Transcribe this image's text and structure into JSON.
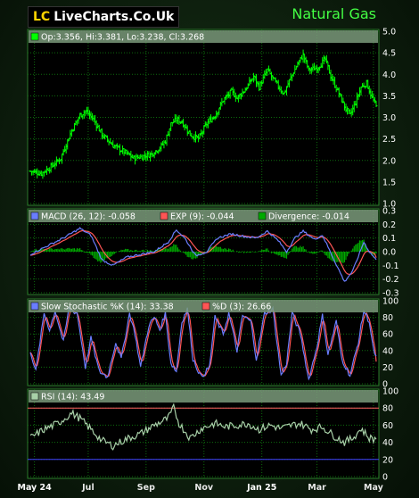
{
  "header": {
    "logo_prefix": "LC",
    "logo_text": "LiveCharts.Co.Uk",
    "title": "Natural Gas"
  },
  "colors": {
    "price": "#00ff00",
    "macd": "#6a7dff",
    "signal": "#ff5555",
    "divergence": "#00aa00",
    "slow_k": "#6a7dff",
    "slow_d": "#ff5555",
    "rsi": "#a8d0a8",
    "grid": "#0d6b0d",
    "rsi_upper": "#ff6060",
    "rsi_lower": "#4040ff"
  },
  "chart_data": [
    {
      "type": "ohlc",
      "legend": "Op:3.356, Hi:3.381, Lo:3.238, Cl:3.268",
      "yticks": [
        "5.0",
        "4.5",
        "4.0",
        "3.5",
        "3.0",
        "2.5",
        "2.0",
        "1.5",
        "1.0"
      ],
      "ylim": [
        1.0,
        5.0
      ],
      "anchors": [
        [
          0,
          1.75
        ],
        [
          8,
          1.7
        ],
        [
          15,
          1.85
        ],
        [
          22,
          2.05
        ],
        [
          30,
          2.7
        ],
        [
          36,
          3.05
        ],
        [
          40,
          3.15
        ],
        [
          46,
          2.95
        ],
        [
          52,
          2.6
        ],
        [
          60,
          2.35
        ],
        [
          68,
          2.2
        ],
        [
          75,
          2.05
        ],
        [
          82,
          2.1
        ],
        [
          88,
          2.15
        ],
        [
          94,
          2.3
        ],
        [
          98,
          2.45
        ],
        [
          102,
          2.85
        ],
        [
          106,
          2.95
        ],
        [
          110,
          2.9
        ],
        [
          116,
          2.6
        ],
        [
          122,
          2.5
        ],
        [
          128,
          2.85
        ],
        [
          134,
          3.05
        ],
        [
          140,
          3.4
        ],
        [
          146,
          3.6
        ],
        [
          150,
          3.45
        ],
        [
          156,
          3.65
        ],
        [
          162,
          3.95
        ],
        [
          166,
          3.7
        ],
        [
          172,
          4.1
        ],
        [
          178,
          3.8
        ],
        [
          184,
          3.55
        ],
        [
          188,
          3.85
        ],
        [
          194,
          4.25
        ],
        [
          198,
          4.45
        ],
        [
          202,
          4.1
        ],
        [
          208,
          4.15
        ],
        [
          214,
          4.35
        ],
        [
          218,
          3.95
        ],
        [
          224,
          3.55
        ],
        [
          228,
          3.25
        ],
        [
          232,
          3.05
        ],
        [
          236,
          3.35
        ],
        [
          240,
          3.7
        ],
        [
          244,
          3.8
        ],
        [
          248,
          3.45
        ],
        [
          251,
          3.27
        ]
      ],
      "last": {
        "open": 3.356,
        "high": 3.381,
        "low": 3.238,
        "close": 3.268
      }
    },
    {
      "type": "macd",
      "legend": {
        "macd": "MACD (26, 12): -0.058",
        "signal": "EXP (9): -0.044",
        "divergence": "Divergence: -0.014"
      },
      "yticks": [
        "0.3",
        "0.2",
        "0.1",
        "0.0",
        "-0.1",
        "-0.2",
        "-0.3"
      ],
      "ylim": [
        -0.3,
        0.3
      ],
      "macd_anchors": [
        [
          0,
          -0.02
        ],
        [
          12,
          0.04
        ],
        [
          24,
          0.1
        ],
        [
          36,
          0.17
        ],
        [
          44,
          0.12
        ],
        [
          52,
          -0.06
        ],
        [
          60,
          -0.1
        ],
        [
          70,
          -0.04
        ],
        [
          80,
          -0.02
        ],
        [
          90,
          0.0
        ],
        [
          100,
          0.07
        ],
        [
          106,
          0.16
        ],
        [
          112,
          0.1
        ],
        [
          120,
          -0.03
        ],
        [
          128,
          0.0
        ],
        [
          136,
          0.1
        ],
        [
          146,
          0.13
        ],
        [
          156,
          0.11
        ],
        [
          164,
          0.1
        ],
        [
          172,
          0.15
        ],
        [
          180,
          0.08
        ],
        [
          186,
          0.0
        ],
        [
          192,
          0.1
        ],
        [
          198,
          0.15
        ],
        [
          206,
          0.09
        ],
        [
          212,
          0.12
        ],
        [
          220,
          -0.05
        ],
        [
          228,
          -0.22
        ],
        [
          234,
          -0.14
        ],
        [
          242,
          0.07
        ],
        [
          246,
          0.0
        ],
        [
          251,
          -0.058
        ]
      ],
      "signal_last": -0.044,
      "divergence_last": -0.014
    },
    {
      "type": "stochastic",
      "legend": {
        "k": "Slow Stochastic %K (14): 33.38",
        "d": "%D (3): 26.66"
      },
      "yticks": [
        "100",
        "80",
        "60",
        "40",
        "20",
        "0"
      ],
      "ylim": [
        0,
        100
      ],
      "k_anchors": [
        [
          0,
          40
        ],
        [
          4,
          15
        ],
        [
          10,
          85
        ],
        [
          14,
          65
        ],
        [
          18,
          88
        ],
        [
          24,
          50
        ],
        [
          28,
          90
        ],
        [
          34,
          85
        ],
        [
          40,
          20
        ],
        [
          44,
          55
        ],
        [
          50,
          15
        ],
        [
          56,
          8
        ],
        [
          62,
          50
        ],
        [
          66,
          30
        ],
        [
          72,
          85
        ],
        [
          76,
          60
        ],
        [
          80,
          20
        ],
        [
          86,
          70
        ],
        [
          90,
          80
        ],
        [
          94,
          65
        ],
        [
          98,
          85
        ],
        [
          102,
          25
        ],
        [
          106,
          15
        ],
        [
          110,
          75
        ],
        [
          114,
          90
        ],
        [
          118,
          30
        ],
        [
          124,
          8
        ],
        [
          130,
          20
        ],
        [
          134,
          80
        ],
        [
          140,
          60
        ],
        [
          144,
          85
        ],
        [
          150,
          40
        ],
        [
          154,
          82
        ],
        [
          160,
          75
        ],
        [
          164,
          30
        ],
        [
          170,
          85
        ],
        [
          176,
          90
        ],
        [
          182,
          10
        ],
        [
          186,
          25
        ],
        [
          190,
          85
        ],
        [
          196,
          60
        ],
        [
          202,
          5
        ],
        [
          208,
          45
        ],
        [
          212,
          82
        ],
        [
          216,
          35
        ],
        [
          222,
          75
        ],
        [
          226,
          30
        ],
        [
          232,
          10
        ],
        [
          238,
          50
        ],
        [
          242,
          88
        ],
        [
          246,
          75
        ],
        [
          249,
          40
        ],
        [
          251,
          33.38
        ]
      ],
      "d_last": 26.66
    },
    {
      "type": "rsi",
      "legend": "RSI (14): 43.49",
      "yticks": [
        "100",
        "80",
        "60",
        "40",
        "20",
        "0"
      ],
      "ylim": [
        0,
        100
      ],
      "levels": [
        80,
        20
      ],
      "rsi_anchors": [
        [
          0,
          45
        ],
        [
          10,
          55
        ],
        [
          20,
          62
        ],
        [
          30,
          74
        ],
        [
          36,
          68
        ],
        [
          44,
          55
        ],
        [
          52,
          42
        ],
        [
          60,
          36
        ],
        [
          70,
          44
        ],
        [
          80,
          50
        ],
        [
          90,
          60
        ],
        [
          100,
          68
        ],
        [
          104,
          80
        ],
        [
          108,
          62
        ],
        [
          116,
          45
        ],
        [
          124,
          56
        ],
        [
          134,
          62
        ],
        [
          142,
          58
        ],
        [
          150,
          60
        ],
        [
          158,
          62
        ],
        [
          166,
          55
        ],
        [
          174,
          60
        ],
        [
          182,
          56
        ],
        [
          190,
          60
        ],
        [
          196,
          62
        ],
        [
          204,
          55
        ],
        [
          212,
          58
        ],
        [
          220,
          48
        ],
        [
          228,
          40
        ],
        [
          234,
          45
        ],
        [
          240,
          56
        ],
        [
          246,
          45
        ],
        [
          251,
          43.49
        ]
      ]
    }
  ],
  "x_axis": {
    "count": 252,
    "labels": [
      {
        "text": "May 24",
        "index": 3,
        "bold": true
      },
      {
        "text": "Jul",
        "index": 42,
        "bold": false
      },
      {
        "text": "Sep",
        "index": 84,
        "bold": false
      },
      {
        "text": "Nov",
        "index": 126,
        "bold": false
      },
      {
        "text": "Jan 25",
        "index": 168,
        "bold": true
      },
      {
        "text": "Mar",
        "index": 208,
        "bold": false
      },
      {
        "text": "May",
        "index": 249,
        "bold": false
      }
    ]
  }
}
